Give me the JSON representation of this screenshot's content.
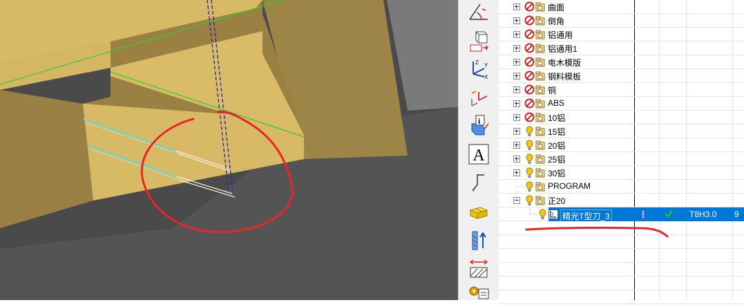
{
  "toolbar": {
    "text_tool_glyph": "A",
    "buttons": [
      {
        "name": "angle-dimension-icon"
      },
      {
        "name": "box-view-icon"
      },
      {
        "name": "xyz-coordinate-icon"
      },
      {
        "name": "transform-coordinate-icon"
      },
      {
        "name": "entity-info-icon"
      },
      {
        "name": "text-icon"
      },
      {
        "name": "polyline-icon"
      },
      {
        "name": "blocks-icon"
      },
      {
        "name": "tool-direction-icon"
      },
      {
        "name": "stock-boundary-icon"
      },
      {
        "name": "settings-gears-icon"
      }
    ]
  },
  "tree": {
    "items": [
      {
        "label": "曲面",
        "state": "disabled",
        "expander": "plus"
      },
      {
        "label": "倒角",
        "state": "disabled",
        "expander": "plus"
      },
      {
        "label": "铝通用",
        "state": "disabled",
        "expander": "plus"
      },
      {
        "label": "铝通用1",
        "state": "disabled",
        "expander": "plus"
      },
      {
        "label": "电木模版",
        "state": "disabled",
        "expander": "plus"
      },
      {
        "label": "钢料模板",
        "state": "disabled",
        "expander": "plus"
      },
      {
        "label": "铜",
        "state": "disabled",
        "expander": "plus"
      },
      {
        "label": "ABS",
        "state": "disabled",
        "expander": "plus"
      },
      {
        "label": "10铝",
        "state": "disabled",
        "expander": "plus"
      },
      {
        "label": "15铝",
        "state": "warning",
        "expander": "plus"
      },
      {
        "label": "20铝",
        "state": "warning",
        "expander": "plus"
      },
      {
        "label": "25铝",
        "state": "warning",
        "expander": "plus"
      },
      {
        "label": "30铝",
        "state": "warning",
        "expander": "plus"
      },
      {
        "label": "PROGRAM",
        "state": "warning",
        "expander": "none"
      },
      {
        "label": "正20",
        "state": "warning",
        "expander": "minus"
      }
    ],
    "selected_operation": {
      "label": "精光T型刀_3",
      "status": "check-icon",
      "tool": "T8H3.0",
      "number": "9"
    }
  },
  "colors": {
    "selection": "#0078d7",
    "part_face": "#d9ba68",
    "part_side": "#9a8244",
    "annotation": "#e8262a",
    "stop_icon": "#d6201d",
    "warning_icon": "#f4c51b",
    "folder_icon": "#c8a03a"
  }
}
